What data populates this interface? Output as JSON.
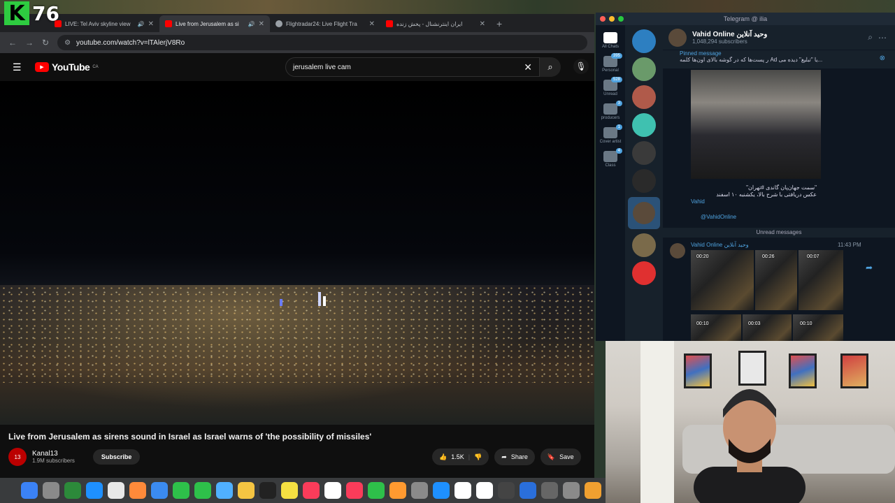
{
  "badge": {
    "letter": "K",
    "number": "76"
  },
  "browser": {
    "tabs": [
      {
        "title": "LIVE: Tel Aviv skyline view",
        "color": "#ff0000",
        "active": false,
        "audio": true
      },
      {
        "title": "Live from Jerusalem as si",
        "color": "#ff0000",
        "active": true,
        "audio": true
      },
      {
        "title": "Flightradar24: Live Flight Tra",
        "color": "#9aa0a6",
        "active": false,
        "audio": false
      },
      {
        "title": "ایران اینترنشنال - پخش زنده",
        "color": "#ff0000",
        "active": false,
        "audio": false
      }
    ],
    "url": "youtube.com/watch?v=lTAlerjV8Ro"
  },
  "youtube": {
    "logo": "YouTube",
    "region": "CA",
    "search_value": "jerusalem live cam",
    "video_title": "Live from Jerusalem as sirens sound in Israel as Israel warns of 'the possibility of missiles'",
    "channel": {
      "name": "Kanal13",
      "subscribers": "1.9M subscribers",
      "avatar_text": "13"
    },
    "subscribe_label": "Subscribe",
    "likes": "1.5K",
    "share_label": "Share",
    "save_label": "Save"
  },
  "telegram": {
    "window_title": "Telegram @ ilia",
    "folders": [
      {
        "label": "All Chats",
        "badge": ""
      },
      {
        "label": "Personal",
        "badge": "395"
      },
      {
        "label": "Unread",
        "badge": "528"
      },
      {
        "label": "producers",
        "badge": "3"
      },
      {
        "label": "Cover artist",
        "badge": "1"
      },
      {
        "label": "Class",
        "badge": "4"
      }
    ],
    "chat": {
      "name": "Vahid Online وحید آنلاین",
      "subscribers": "1,048,294 subscribers"
    },
    "pinned": {
      "title": "Pinned message",
      "text": "ر پست‌ها که در گوشه بالای اون‌ها کلمه Ad یا \"تبلیغ\" دیده می..."
    },
    "post": {
      "caption_line1": "\"سمت جهان‌پان گاندی #تهران\"",
      "caption_line2": "عکس دریافتی با شرح بالا، یکشنبه ۱۰ اسفند",
      "signature": "Vahid",
      "handle": "@VahidOnline"
    },
    "unread_label": "Unread messages",
    "second_post": {
      "author": "Vahid Online وحید آنلاین",
      "time": "11:43 PM",
      "durations": [
        "00:20",
        "00:26",
        "00:07",
        "00:10",
        "00:03",
        "00:10"
      ]
    }
  },
  "dock_icons": [
    "finder-icon",
    "launchpad-icon",
    "app-icon",
    "safari-icon",
    "chrome-icon",
    "photos-icon",
    "mail-icon",
    "facetime-icon",
    "messages-icon",
    "maps-icon",
    "notes-icon",
    "tv-icon",
    "stickies-icon",
    "music-icon",
    "calendar-icon",
    "news-icon",
    "numbers-icon",
    "pages-icon",
    "settings-icon",
    "appstore-icon",
    "notion-icon",
    "calendar2-icon",
    "app2-icon",
    "app3-icon",
    "app4-icon",
    "app5-icon",
    "app6-icon"
  ]
}
